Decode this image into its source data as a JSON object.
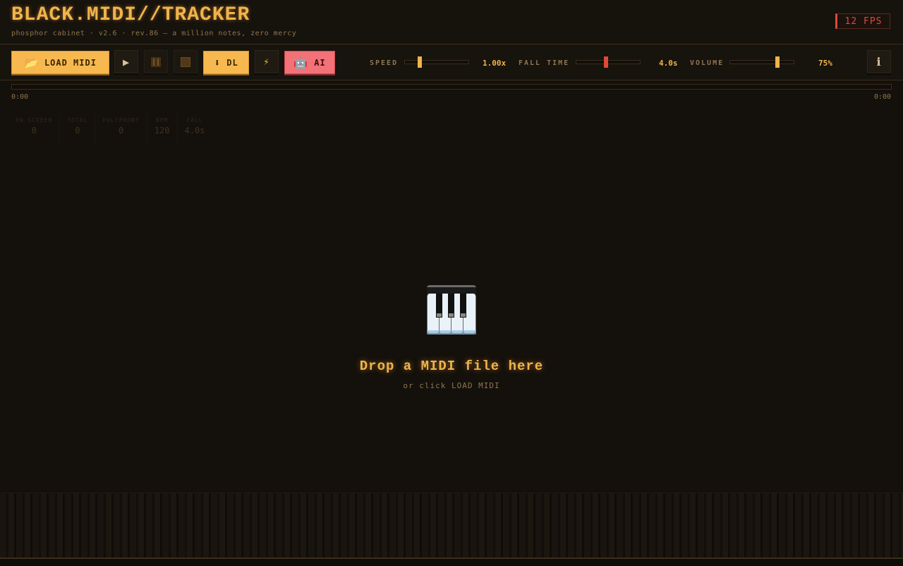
{
  "app": {
    "title": "BLACK.MIDI//TRACKER",
    "subtitle": "phosphor cabinet · v2.6 · rev.86 — a million notes, zero mercy",
    "fps": "12 FPS"
  },
  "toolbar": {
    "load_icon": "📂",
    "load_label": "LOAD MIDI",
    "play_icon": "▶",
    "dl_icon": "⬇",
    "dl_label": "DL",
    "flash_icon": "⚡",
    "ai_icon": "🤖",
    "ai_label": "AI",
    "info_icon": "i"
  },
  "sliders": {
    "speed": {
      "label": "SPEED",
      "value": "1.00x",
      "level": 0.22
    },
    "fall_time": {
      "label": "FALL TIME",
      "value": "4.0s",
      "level": 0.46
    },
    "volume": {
      "label": "VOLUME",
      "value": "75%",
      "level": 0.75
    }
  },
  "timeline": {
    "current": "0:00",
    "total": "0:00",
    "progress": 0
  },
  "stats": [
    {
      "label": "ON SCREEN",
      "value": "0"
    },
    {
      "label": "TOTAL",
      "value": "0"
    },
    {
      "label": "POLYPHONY",
      "value": "0"
    },
    {
      "label": "BPM",
      "value": "120"
    },
    {
      "label": "FALL",
      "value": "4.0s"
    }
  ],
  "dropzone": {
    "title": "Drop a MIDI file here",
    "subtitle": "or click LOAD MIDI"
  },
  "colors": {
    "accent": "#f0b44a",
    "danger": "#e2483a",
    "thumb_red": "#e2483a"
  }
}
